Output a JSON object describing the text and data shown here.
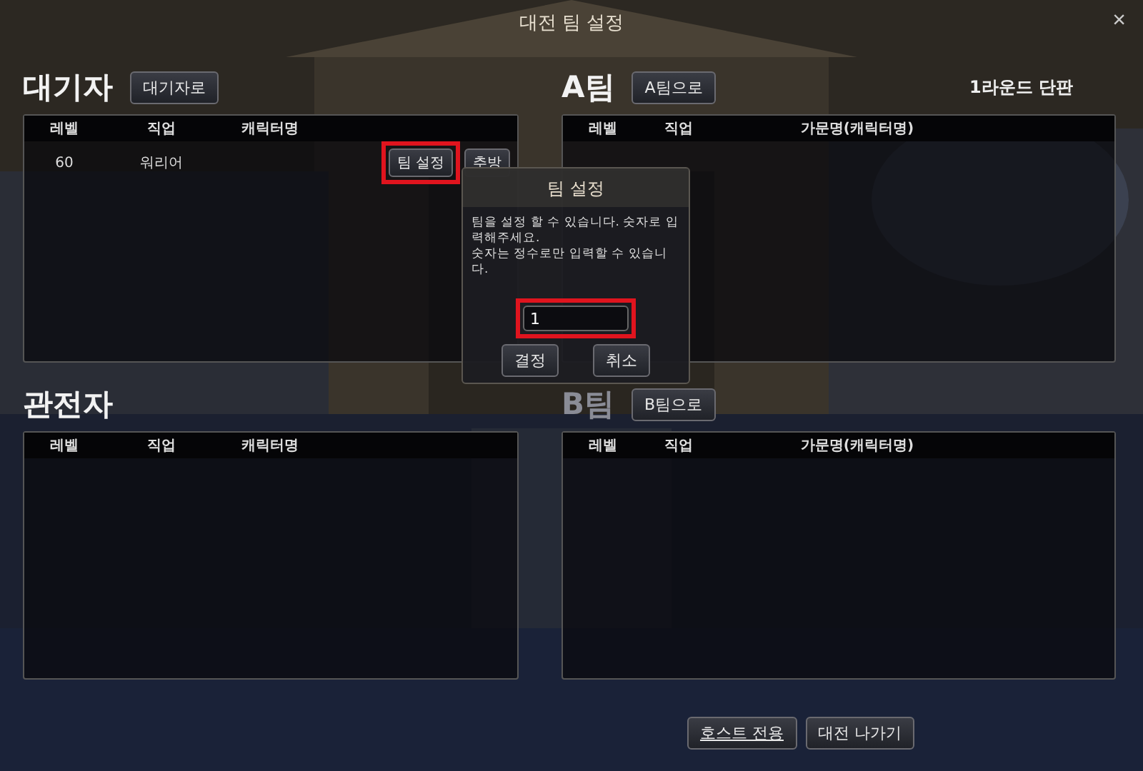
{
  "window": {
    "title": "대전 팀 설정",
    "close": "×"
  },
  "waiting": {
    "title": "대기자",
    "move_button": "대기자로",
    "columns": [
      "레벨",
      "직업",
      "캐릭터명"
    ],
    "rows": [
      {
        "level": "60",
        "class": "워리어",
        "team_button": "팀 설정",
        "team_button_highlighted": true,
        "kick_button": "추방"
      }
    ]
  },
  "team_a": {
    "title": "A팀",
    "move_button": "A팀으로",
    "round_info": "1라운드 단판",
    "columns": [
      "레벨",
      "직업",
      "가문명(캐릭터명)"
    ]
  },
  "spectators": {
    "title": "관전자",
    "columns": [
      "레벨",
      "직업",
      "캐릭터명"
    ]
  },
  "team_b": {
    "title": "B팀",
    "move_button": "B팀으로",
    "columns": [
      "레벨",
      "직업",
      "가문명(캐릭터명)"
    ]
  },
  "footer_buttons": [
    "호스트 전용",
    "대전 나가기"
  ],
  "dialog": {
    "title": "팀 설정",
    "message_lines": [
      "팀을 설정 할 수 있습니다. 숫자로 입력해주세요.",
      "숫자는 정수로만 입력할 수 있습니다."
    ],
    "input": {
      "value": "1",
      "highlighted": true
    },
    "buttons": [
      "결정",
      "취소"
    ]
  }
}
